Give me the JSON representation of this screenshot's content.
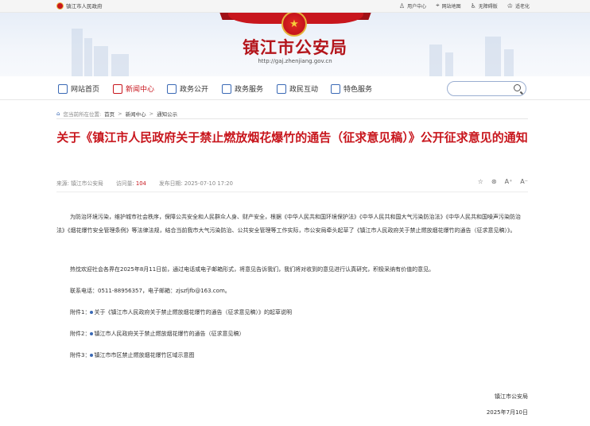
{
  "topbar": {
    "site_name": "镇江市人民政府",
    "links": [
      {
        "icon": "user-icon",
        "label": "用户中心"
      },
      {
        "icon": "location-icon",
        "label": "网站地图"
      },
      {
        "icon": "accessibility-icon",
        "label": "无障碍版"
      },
      {
        "icon": "elderly-icon",
        "label": "适老化"
      }
    ]
  },
  "banner": {
    "title": "镇江市公安局",
    "url": "http://gaj.zhenjiang.gov.cn"
  },
  "nav": {
    "items": [
      {
        "label": "网站首页",
        "icon": "home-icon"
      },
      {
        "label": "新闻中心",
        "icon": "news-icon",
        "active": true
      },
      {
        "label": "政务公开",
        "icon": "layers-icon"
      },
      {
        "label": "政务服务",
        "icon": "service-icon"
      },
      {
        "label": "政民互动",
        "icon": "chat-icon"
      },
      {
        "label": "特色服务",
        "icon": "feature-icon"
      }
    ],
    "search_placeholder": ""
  },
  "breadcrumb": {
    "prefix": "您当前所在位置:",
    "items": [
      "首页",
      "新闻中心",
      "通知公示"
    ]
  },
  "article": {
    "title": "关于《镇江市人民政府关于禁止燃放烟花爆竹的通告（征求意见稿）》公开征求意见的通知",
    "source_label": "来源:",
    "source": "镇江市公安局",
    "visits_label": "访问量:",
    "visits": "104",
    "date_label": "发布日期:",
    "date": "2025-07-10 17:20",
    "para1": "为防治环境污染，维护城市社会秩序，保障公共安全和人民群众人身、财产安全，根据《中华人民共和国环境保护法》《中华人民共和国大气污染防治法》《中华人民共和国噪声污染防治法》《烟花爆竹安全管理条例》等法律法规，结合当前我市大气污染防治、公共安全管理等工作实际，市公安局牵头起草了《镇江市人民政府关于禁止燃放烟花爆竹的通告（征求意见稿）》。",
    "para2": "热忱欢迎社会各界在2025年8月11日前，通过电话或电子邮箱形式，将意见告诉我们，我们将对收到的意见进行认真研究，积极采纳有价值的意见。",
    "contact": "联系电话：0511-88956357，电子邮箱：zjszfjfb@163.com。",
    "attachments": [
      {
        "label": "附件1：",
        "name": "关于《镇江市人民政府关于禁止燃放烟花爆竹的通告（征求意见稿）》的起草说明"
      },
      {
        "label": "附件2：",
        "name": "镇江市人民政府关于禁止燃放烟花爆竹的通告（征求意见稿）"
      },
      {
        "label": "附件3：",
        "name": "镇江市市区禁止燃放烟花爆竹区域示意图"
      }
    ],
    "signature": "镇江市公安局",
    "sign_date": "2025年7月10日"
  },
  "colors": {
    "accent": "#c8161d",
    "nav_icon": "#3a69b5"
  }
}
